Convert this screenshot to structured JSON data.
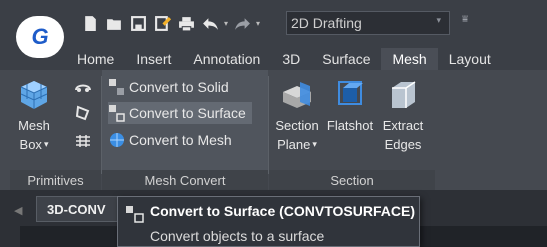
{
  "app": {
    "logo_letter": "G"
  },
  "quick_access": {
    "icons": [
      "new-file-icon",
      "open-folder-icon",
      "save-icon",
      "save-as-icon",
      "print-icon",
      "undo-icon",
      "redo-icon"
    ],
    "workspace": "2D Drafting"
  },
  "tabs": [
    {
      "label": "Home",
      "active": false
    },
    {
      "label": "Insert",
      "active": false
    },
    {
      "label": "Annotation",
      "active": false
    },
    {
      "label": "3D",
      "active": false
    },
    {
      "label": "Surface",
      "active": false
    },
    {
      "label": "Mesh",
      "active": true
    },
    {
      "label": "Layout",
      "active": false
    }
  ],
  "ribbon": {
    "primitives": {
      "title": "Primitives",
      "mesh_box": {
        "line1": "Mesh",
        "line2": "Box"
      }
    },
    "mesh_convert": {
      "title": "Mesh Convert",
      "convert_to_solid": "Convert to Solid",
      "convert_to_surface": "Convert to Surface",
      "convert_to_mesh": "Convert to Mesh"
    },
    "section": {
      "title": "Section",
      "section_plane": {
        "line1": "Section",
        "line2": "Plane"
      },
      "flatshot": "Flatshot",
      "extract_edges": {
        "line1": "Extract",
        "line2": "Edges"
      }
    }
  },
  "document": {
    "tab_label": "3D-CONV"
  },
  "tooltip": {
    "title": "Convert to Surface (CONVTOSURFACE)",
    "description": "Convert objects to a surface"
  },
  "colors": {
    "accent": "#1e5cc9",
    "ribbon_bg": "#454950",
    "highlight": "#646a73"
  }
}
